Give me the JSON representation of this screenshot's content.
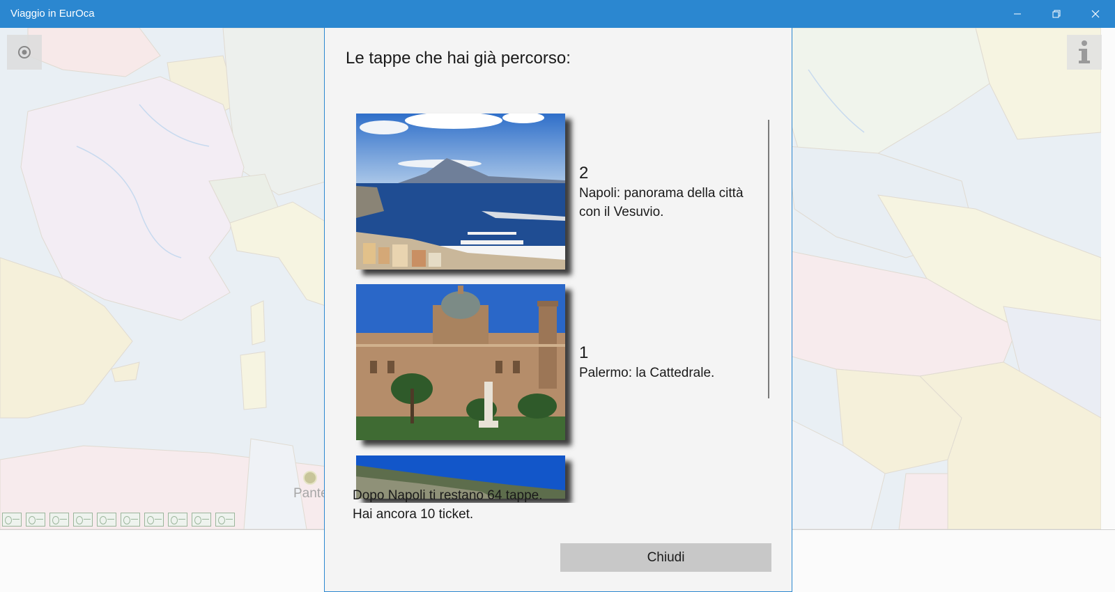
{
  "window": {
    "title": "Viaggio in EurOca",
    "minimize_icon": "minimize-icon",
    "restore_icon": "restore-icon",
    "close_icon": "close-icon"
  },
  "map": {
    "location_button_icon": "locate-icon",
    "info_button_icon": "info-icon",
    "visible_label": "Pante",
    "tickets_icon": "ticket-icon",
    "ticket_count_shown": 10
  },
  "dialog": {
    "title": "Le tappe che hai già percorso:",
    "stages": [
      {
        "number": "2",
        "description": "Napoli: panorama della città con il Vesuvio."
      },
      {
        "number": "1",
        "description": "Palermo: la Cattedrale."
      },
      {
        "number": "",
        "description": ""
      }
    ],
    "summary_line1": "Dopo Napoli ti restano 64 tappe.",
    "summary_line2": "Hai ancora 10 ticket.",
    "close_label": "Chiudi"
  },
  "colors": {
    "titlebar": "#2b87d0",
    "dialog_background": "#f4f4f4",
    "button": "#c8c8c8"
  }
}
